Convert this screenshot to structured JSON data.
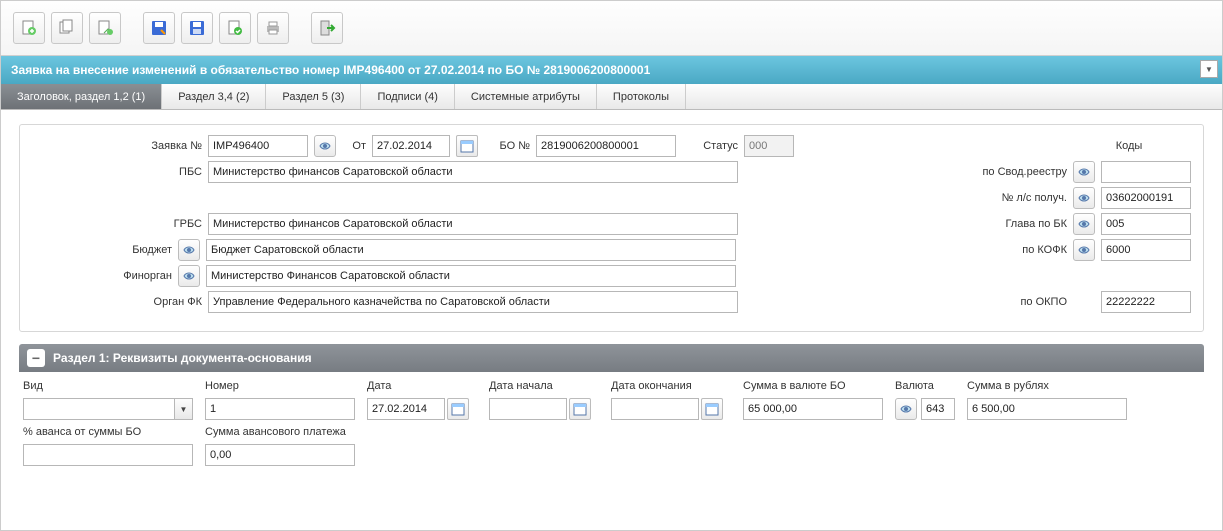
{
  "header": {
    "title": "Заявка на внесение изменений в обязательство номер IMP496400 от 27.02.2014 по БО № 2819006200800001"
  },
  "tabs": [
    {
      "label": "Заголовок, раздел 1,2 (1)"
    },
    {
      "label": "Раздел 3,4 (2)"
    },
    {
      "label": "Раздел 5 (3)"
    },
    {
      "label": "Подписи (4)"
    },
    {
      "label": "Системные атрибуты"
    },
    {
      "label": "Протоколы"
    }
  ],
  "form": {
    "request_no_label": "Заявка №",
    "request_no": "IMP496400",
    "date_label": "От",
    "date": "27.02.2014",
    "bo_no_label": "БО №",
    "bo_no": "2819006200800001",
    "status_label": "Статус",
    "status": "000",
    "codes_label": "Коды",
    "pbs_label": "ПБС",
    "pbs": "Министерство финансов Саратовской области",
    "grbs_label": "ГРБС",
    "grbs": "Министерство финансов Саратовской области",
    "budget_label": "Бюджет",
    "budget": "Бюджет Саратовской области",
    "finorg_label": "Финорган",
    "finorg": "Министерство Финансов Саратовской области",
    "orgfk_label": "Орган ФК",
    "orgfk": "Управление Федерального казначейства по Саратовской области",
    "code_svod_label": "по Свод.реестру",
    "code_svod": "",
    "code_ls_label": "№ л/с получ.",
    "code_ls": "03602000191",
    "code_glava_label": "Глава по БК",
    "code_glava": "005",
    "code_kofk_label": "по КОФК",
    "code_kofk": "6000",
    "code_okpo_label": "по ОКПО",
    "code_okpo": "22222222"
  },
  "section1": {
    "title": "Раздел 1: Реквизиты документа-основания",
    "cols": {
      "kind": "Вид",
      "number": "Номер",
      "date": "Дата",
      "date_start": "Дата начала",
      "date_end": "Дата окончания",
      "sum_bo": "Сумма в валюте БО",
      "currency": "Валюта",
      "sum_rub": "Сумма в рублях",
      "avans_pct": "% аванса от суммы БО",
      "avans_sum": "Сумма авансового платежа"
    },
    "vals": {
      "kind": "",
      "number": "1",
      "date": "27.02.2014",
      "date_start": "",
      "date_end": "",
      "sum_bo": "65 000,00",
      "currency": "643",
      "sum_rub": "6 500,00",
      "avans_pct": "",
      "avans_sum": "0,00"
    }
  }
}
